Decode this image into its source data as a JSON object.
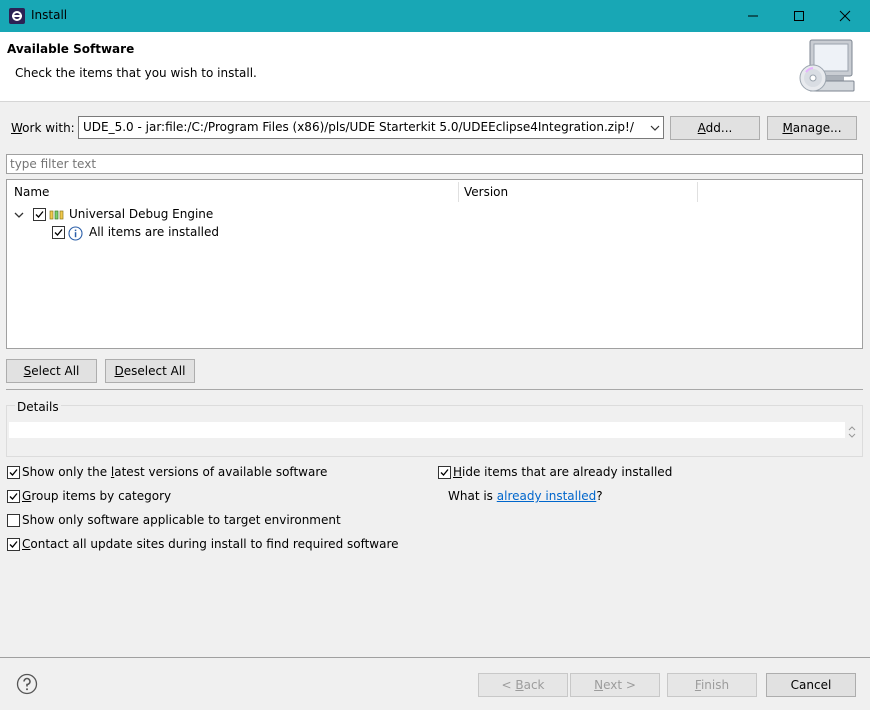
{
  "window": {
    "title": "Install"
  },
  "header": {
    "title": "Available Software",
    "description": "Check the items that you wish to install."
  },
  "work_with": {
    "label": "Work with:",
    "value": "UDE_5.0 - jar:file:/C:/Program Files (x86)/pls/UDE Starterkit 5.0/UDEEclipse4Integration.zip!/",
    "add_label": "Add...",
    "manage_label": "Manage..."
  },
  "filter": {
    "placeholder": "type filter text"
  },
  "tree": {
    "columns": [
      "Name",
      "Version"
    ],
    "items": [
      {
        "label": "Universal Debug Engine",
        "checked": true,
        "expanded": true
      },
      {
        "label": "All items are installed",
        "checked": true
      }
    ]
  },
  "selection": {
    "select_all": "Select All",
    "deselect_all": "Deselect All"
  },
  "details": {
    "label": "Details"
  },
  "options": {
    "latest_versions": {
      "label": "Show only the latest versions of available software",
      "checked": true
    },
    "group_by_category": {
      "label": "Group items by category",
      "checked": true
    },
    "target_env": {
      "label": "Show only software applicable to target environment",
      "checked": false
    },
    "contact_sites": {
      "label": "Contact all update sites during install to find required software",
      "checked": true
    },
    "hide_installed": {
      "label": "Hide items that are already installed",
      "checked": true
    },
    "what_is_prefix": "What is ",
    "what_is_link": "already installed",
    "what_is_suffix": "?"
  },
  "footer": {
    "back": "< Back",
    "next": "Next >",
    "finish": "Finish",
    "cancel": "Cancel"
  },
  "colors": {
    "titlebar": "#18a7b5",
    "link": "#0066cc"
  }
}
